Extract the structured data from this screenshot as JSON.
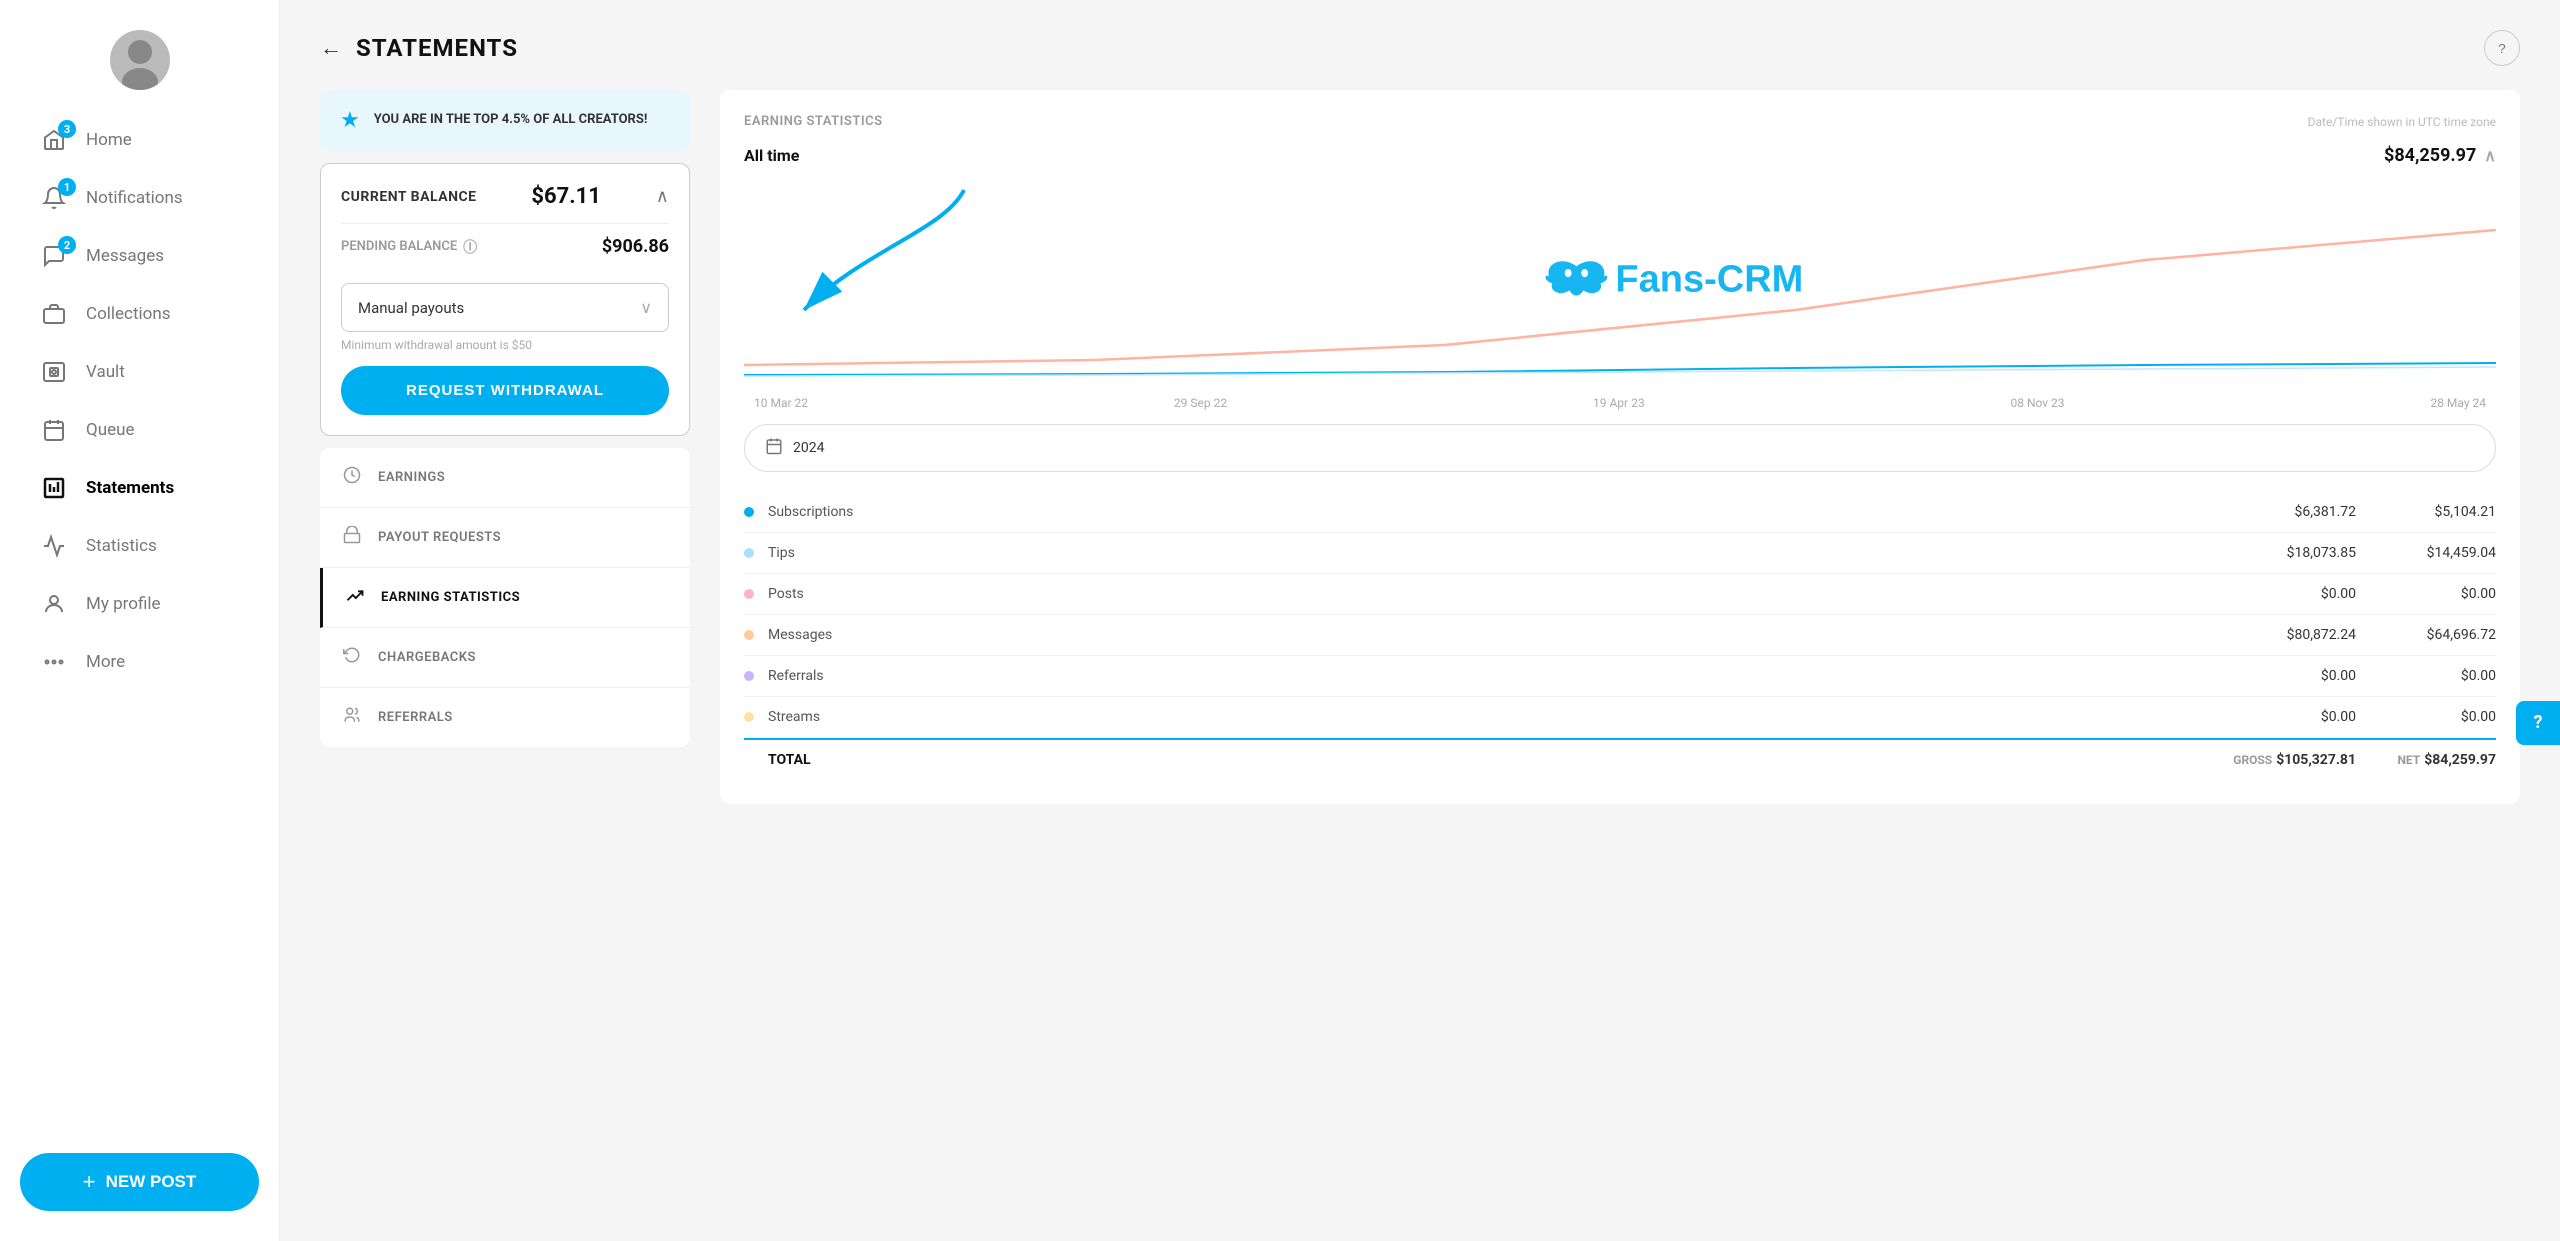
{
  "sidebar": {
    "avatar_emoji": "🧑",
    "nav_items": [
      {
        "id": "home",
        "label": "Home",
        "icon": "🏠",
        "badge": 3
      },
      {
        "id": "notifications",
        "label": "Notifications",
        "icon": "🔔",
        "badge": 1
      },
      {
        "id": "messages",
        "label": "Messages",
        "icon": "💬",
        "badge": 2
      },
      {
        "id": "collections",
        "label": "Collections",
        "icon": "👥",
        "badge": null
      },
      {
        "id": "vault",
        "label": "Vault",
        "icon": "🖼️",
        "badge": null
      },
      {
        "id": "queue",
        "label": "Queue",
        "icon": "📅",
        "badge": null
      },
      {
        "id": "statements",
        "label": "Statements",
        "icon": "📊",
        "badge": null,
        "active": true
      },
      {
        "id": "statistics",
        "label": "Statistics",
        "icon": "📈",
        "badge": null
      },
      {
        "id": "myprofile",
        "label": "My profile",
        "icon": "👤",
        "badge": null
      },
      {
        "id": "more",
        "label": "More",
        "icon": "···",
        "badge": null
      }
    ],
    "new_post_label": "NEW POST"
  },
  "header": {
    "back_label": "←",
    "title": "STATEMENTS",
    "help_icon": "?"
  },
  "top_creator": {
    "text": "YOU ARE IN THE TOP 4.5% OF ALL CREATORS!"
  },
  "balance": {
    "current_label": "CURRENT BALANCE",
    "current_amount": "$67.11",
    "pending_label": "PENDING BALANCE",
    "pending_amount": "$906.86",
    "payout_method": "Manual payouts",
    "min_withdrawal": "Minimum withdrawal amount is $50",
    "request_btn": "REQUEST WITHDRAWAL"
  },
  "sections": [
    {
      "id": "earnings",
      "label": "EARNINGS",
      "icon": "💰"
    },
    {
      "id": "payout-requests",
      "label": "PAYOUT REQUESTS",
      "icon": "🏛️"
    },
    {
      "id": "earning-statistics",
      "label": "EARNING STATISTICS",
      "icon": "📈",
      "active": true
    },
    {
      "id": "chargebacks",
      "label": "CHARGEBACKS",
      "icon": "↩️"
    },
    {
      "id": "referrals",
      "label": "REFERRALS",
      "icon": "👥"
    }
  ],
  "earning_statistics": {
    "title": "EARNING STATISTICS",
    "utc_note": "Date/Time shown in UTC time zone",
    "time_filter": "All time",
    "total_display": "$84,259.97",
    "chart_dates": [
      "10 Mar 22",
      "29 Sep 22",
      "19 Apr 23",
      "08 Nov 23",
      "28 May 24"
    ],
    "date_picker_value": "2024",
    "stats_rows": [
      {
        "id": "subscriptions",
        "label": "Subscriptions",
        "color": "#00aff0",
        "gross": "$6,381.72",
        "net": "$5,104.21"
      },
      {
        "id": "tips",
        "label": "Tips",
        "color": "#aaddff",
        "gross": "$18,073.85",
        "net": "$14,459.04"
      },
      {
        "id": "posts",
        "label": "Posts",
        "color": "#ffb3c6",
        "gross": "$0.00",
        "net": "$0.00"
      },
      {
        "id": "messages",
        "label": "Messages",
        "color": "#ffcc99",
        "gross": "$80,872.24",
        "net": "$64,696.72"
      },
      {
        "id": "referrals",
        "label": "Referrals",
        "color": "#c9b3ff",
        "gross": "$0.00",
        "net": "$0.00"
      },
      {
        "id": "streams",
        "label": "Streams",
        "color": "#ffe0a0",
        "gross": "$0.00",
        "net": "$0.00"
      }
    ],
    "total_row": {
      "label": "TOTAL",
      "gross_label": "GROSS",
      "gross": "$105,327.81",
      "net_label": "NET",
      "net": "$84,259.97"
    }
  },
  "floating_help": "?"
}
